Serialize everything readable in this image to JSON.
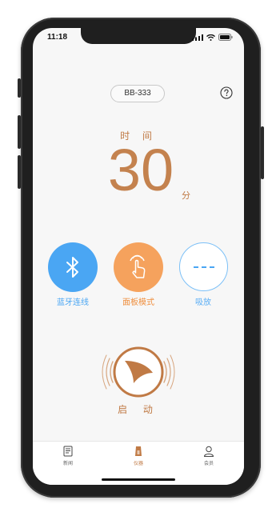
{
  "status_bar": {
    "time": "11:18"
  },
  "header": {
    "device_id": "BB-333",
    "help_icon": "question-circle-icon"
  },
  "timer": {
    "label": "时 间",
    "value": "30",
    "unit": "分"
  },
  "functions": [
    {
      "label": "蓝牙连线",
      "icon": "bluetooth-icon",
      "color": "#4aa6f3"
    },
    {
      "label": "面板模式",
      "icon": "hand-tap-icon",
      "color": "#f5a25d"
    },
    {
      "label": "吸放",
      "icon": "dots-icon",
      "color": "#7cc0f7"
    }
  ],
  "start": {
    "label": "启 动",
    "icon": "start-logo-icon",
    "color": "#c07a45"
  },
  "tabs": [
    {
      "label": "新闻",
      "icon": "document-icon"
    },
    {
      "label": "仪器",
      "icon": "device-icon",
      "active": true
    },
    {
      "label": "会员",
      "icon": "user-icon"
    }
  ]
}
